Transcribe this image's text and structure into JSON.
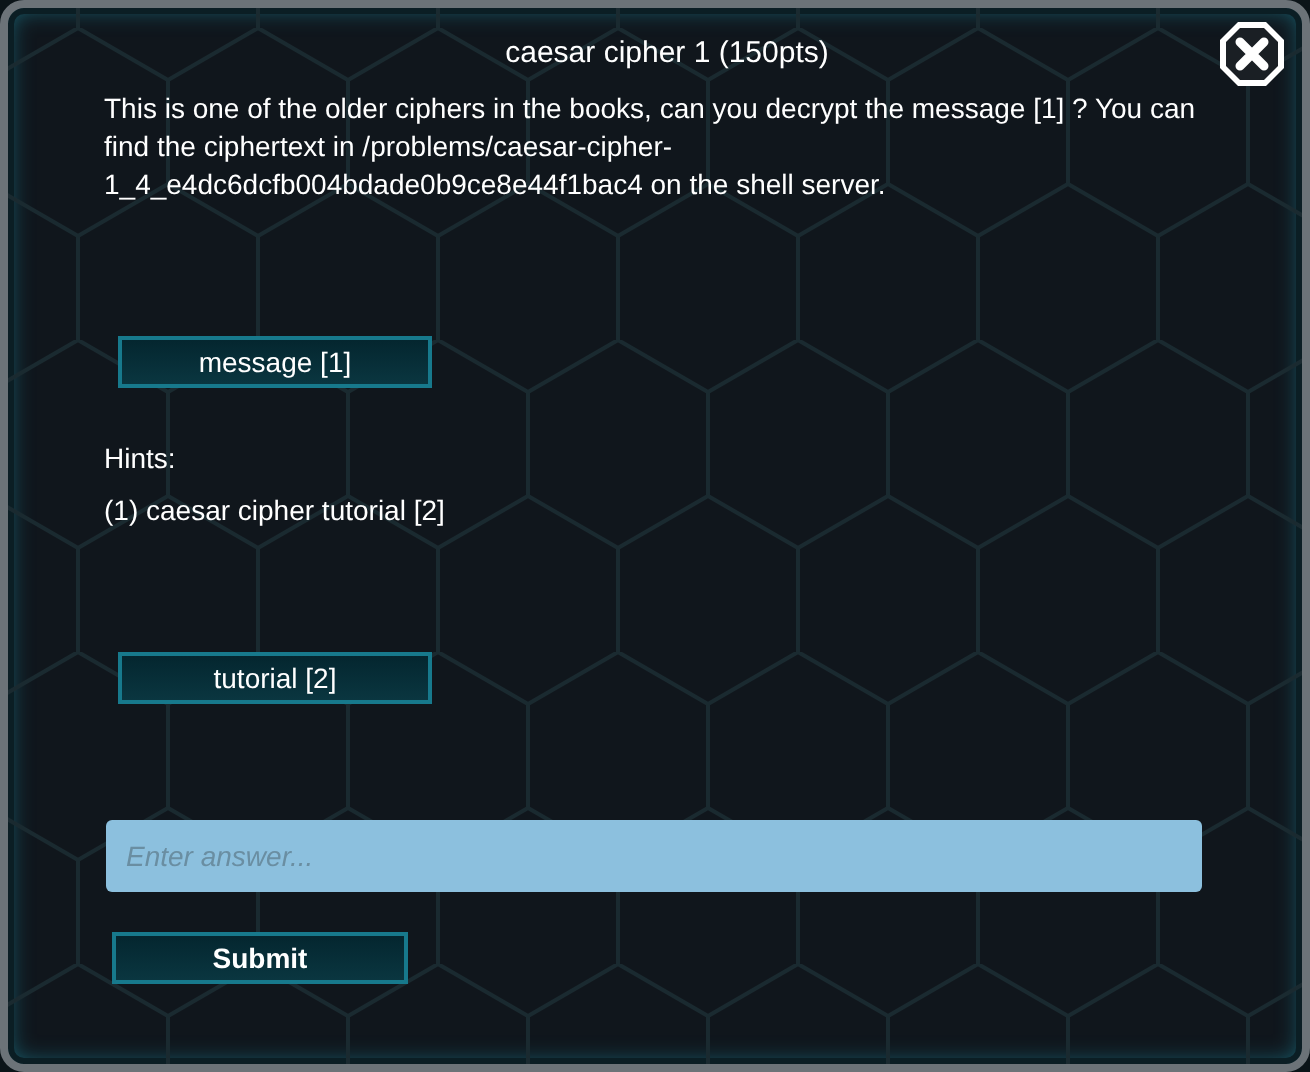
{
  "dialog": {
    "title": "caesar cipher 1 (150pts)",
    "description": "This is one of the older ciphers in the books, can you decrypt the message [1] ? You can find the ciphertext in /problems/caesar-cipher-1_4_e4dc6dcfb004bdade0b9ce8e44f1bac4 on the shell server.",
    "link_button": "message [1]",
    "hints_label": "Hints:",
    "hints": [
      "(1) caesar cipher tutorial [2]"
    ],
    "hint_buttons": [
      "tutorial [2]"
    ],
    "answer": {
      "placeholder": "Enter answer..."
    },
    "submit": "Submit"
  }
}
